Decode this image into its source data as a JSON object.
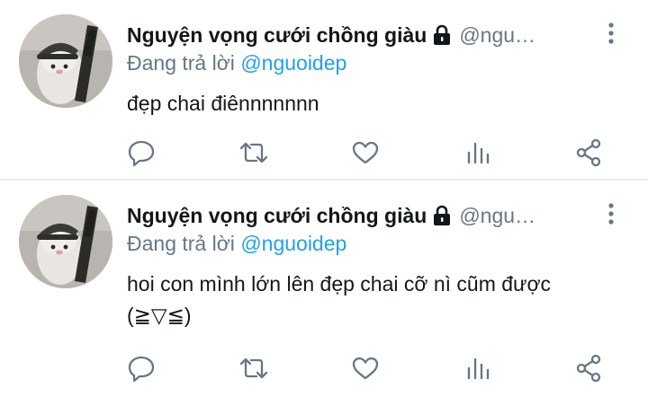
{
  "tweets": [
    {
      "display_name": "Nguyện vọng cưới chồng giàu",
      "handle": "@ngu…",
      "reply_prefix": "Đang trả lời",
      "reply_to": "@nguoidep",
      "text": "đẹp chai điênnnnnnn",
      "avatar": "avatar-photo",
      "icons": [
        "lock-icon",
        "more-icon",
        "reply-icon",
        "retweet-icon",
        "like-icon",
        "stats-icon",
        "share-icon"
      ]
    },
    {
      "display_name": "Nguyện vọng cưới chồng giàu",
      "handle": "@ngu…",
      "reply_prefix": "Đang trả lời",
      "reply_to": "@nguoidep",
      "text": "hoi con mình lớn lên đẹp chai cỡ nì cũm được (≧▽≦)",
      "avatar": "avatar-photo",
      "icons": [
        "lock-icon",
        "more-icon",
        "reply-icon",
        "retweet-icon",
        "like-icon",
        "stats-icon",
        "share-icon"
      ]
    }
  ],
  "colors": {
    "text": "#14171a",
    "secondary": "#657786",
    "link": "#1da1f2",
    "divider": "#e6ecf0",
    "icon": "#657786"
  }
}
